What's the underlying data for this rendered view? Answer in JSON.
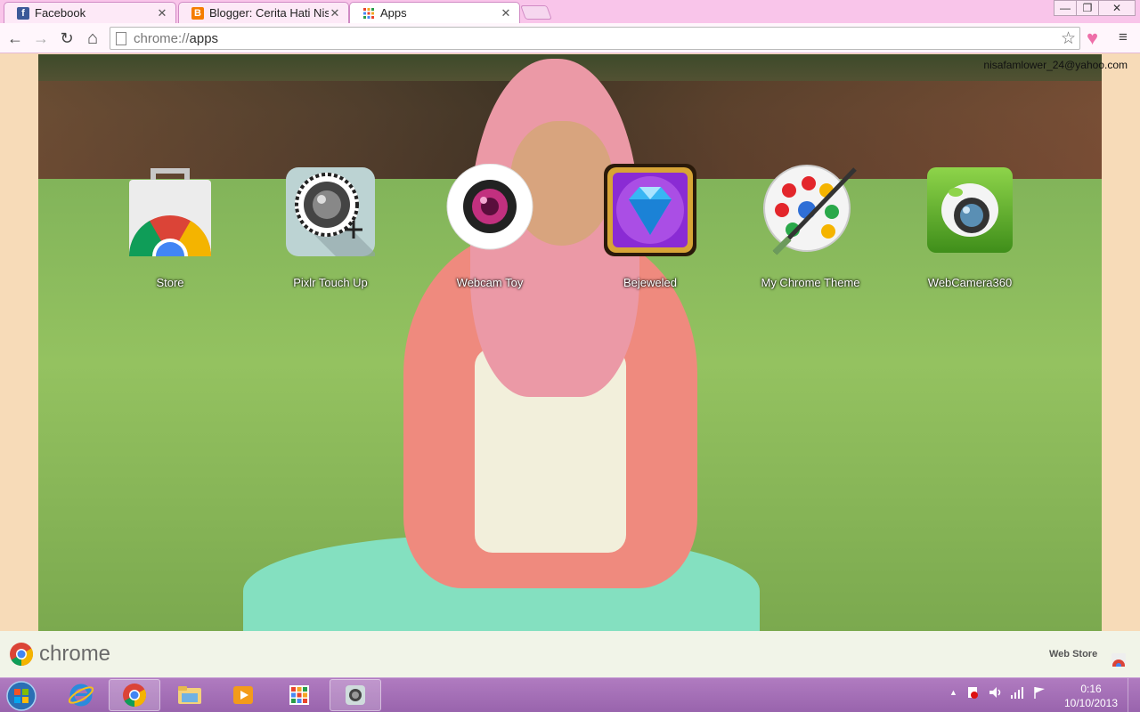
{
  "tabs": [
    {
      "title": "Facebook",
      "close": "✕",
      "favicon_color": "#3b5998",
      "favicon_glyph": "f"
    },
    {
      "title": "Blogger: Cerita Hati Nisa - ",
      "close": "✕",
      "favicon_color": "#f57d00",
      "favicon_glyph": "B"
    },
    {
      "title": "Apps",
      "close": "✕",
      "favicon_color": "#e8452c",
      "favicon_glyph": ""
    }
  ],
  "window_controls": {
    "minimize": "—",
    "restore": "❐",
    "close": "✕"
  },
  "toolbar": {
    "back_glyph": "←",
    "forward_glyph": "→",
    "reload_glyph": "↻",
    "home_glyph": "⌂",
    "url_scheme": "chrome://",
    "url_path": "apps",
    "star_glyph": "☆",
    "heart_glyph": "♥",
    "menu_glyph": "≡"
  },
  "watermark": "nisafamlower_24@yahoo.com",
  "apps": [
    {
      "label": "Store",
      "icon": "chrome-web-store-icon"
    },
    {
      "label": "Pixlr Touch Up",
      "icon": "pixlr-camera-icon"
    },
    {
      "label": "Webcam Toy",
      "icon": "webcam-lens-icon"
    },
    {
      "label": "Bejeweled",
      "icon": "diamond-gem-icon"
    },
    {
      "label": "My Chrome Theme",
      "icon": "paint-palette-icon"
    },
    {
      "label": "WebCamera360",
      "icon": "camera360-icon"
    }
  ],
  "launcher": {
    "brand": "chrome",
    "webstore": "Web Store"
  },
  "taskbar": {
    "items": [
      "internet-explorer-icon",
      "chrome-icon",
      "file-explorer-icon",
      "media-player-icon",
      "apps-grid-icon",
      "camera-app-icon"
    ],
    "tray_up": "▲",
    "clock_time": "0:16",
    "clock_date": "10/10/2013"
  },
  "colors": {
    "tabstrip": "#f9c5ea",
    "taskbar": "#9964ad",
    "accent_heart": "#ee6fa9"
  }
}
